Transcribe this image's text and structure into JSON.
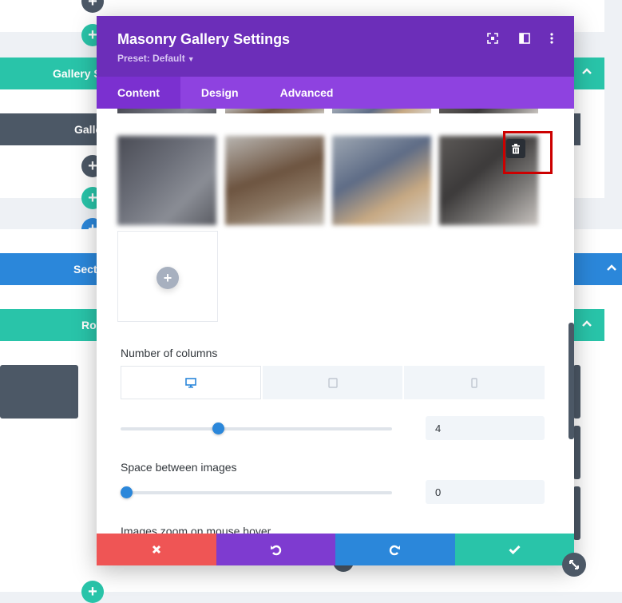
{
  "background": {
    "gallery_section_label": "Gallery S",
    "gallery_module_label": "Galle",
    "section_label": "Sect",
    "row_label": "Ro"
  },
  "modal": {
    "title": "Masonry Gallery Settings",
    "preset": "Preset: Default",
    "tabs": [
      "Content",
      "Design",
      "Advanced"
    ],
    "active_tab": "Content",
    "columns": {
      "label": "Number of columns",
      "devices": [
        "desktop",
        "tablet",
        "phone"
      ],
      "active_device": "desktop",
      "value": "4",
      "slider_fraction": 0.35
    },
    "spacing": {
      "label": "Space between images",
      "value": "0",
      "slider_fraction": 0
    },
    "zoom": {
      "label": "Images zoom on mouse hover"
    }
  },
  "colors": {
    "header": "#6c2eb9",
    "tabs": "#8e42e0",
    "teal": "#29c4a9",
    "blue": "#2b87da",
    "slate": "#4c5866",
    "red": "#ef5555",
    "highlight": "#cc0000"
  }
}
